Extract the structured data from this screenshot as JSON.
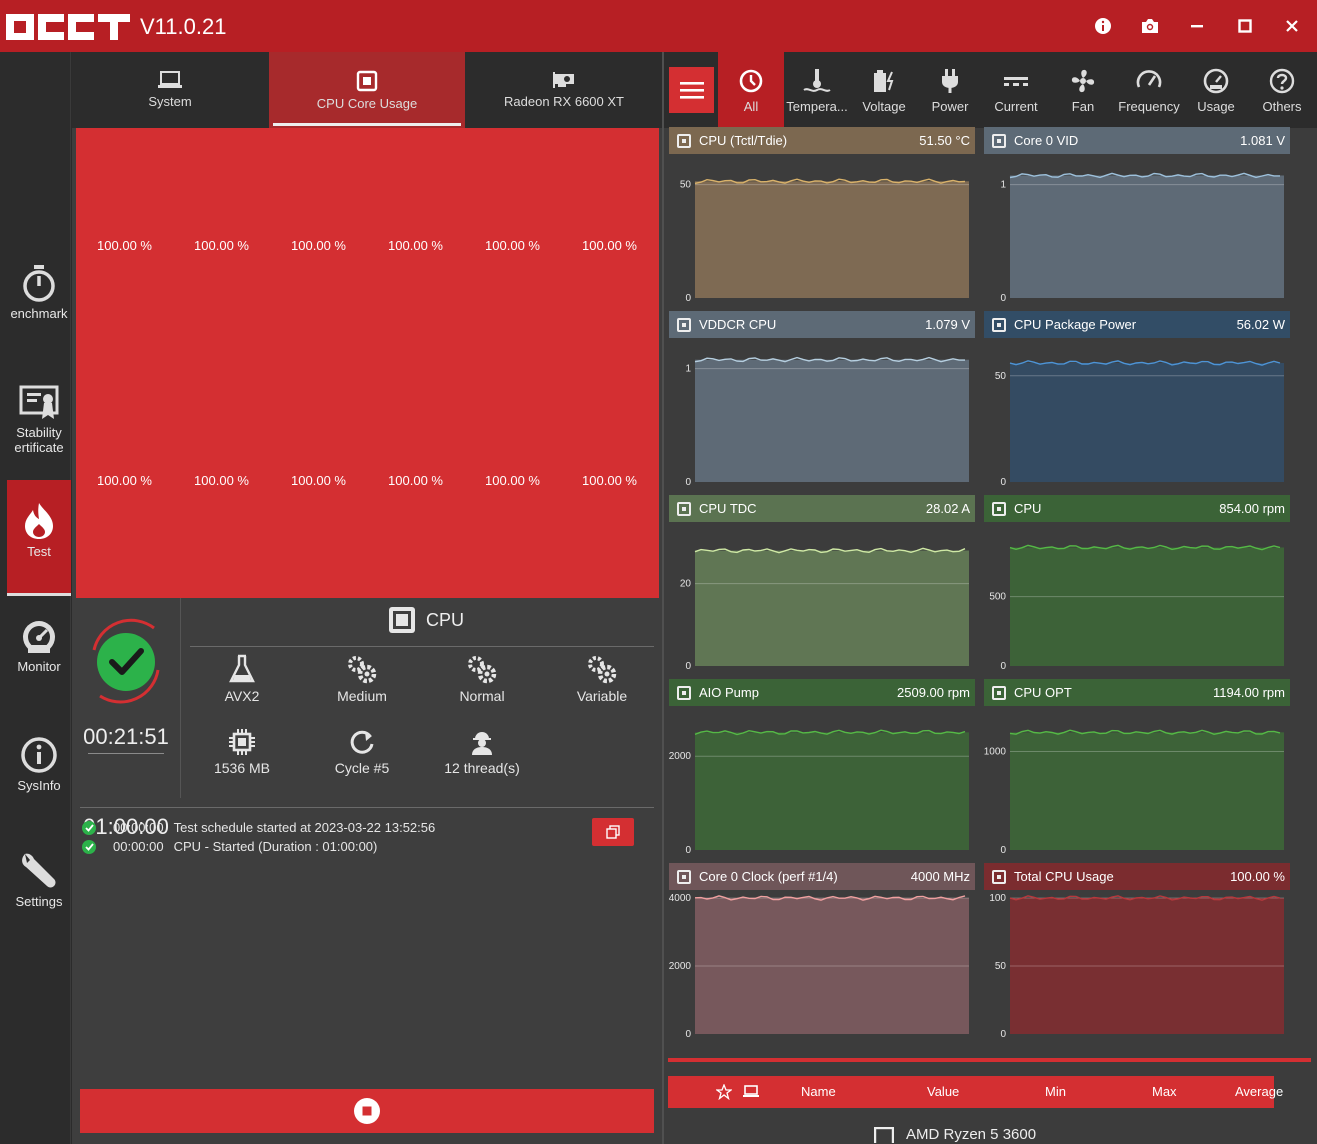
{
  "app": {
    "version": "V11.0.21"
  },
  "rail": {
    "items": [
      {
        "label": "enchmark"
      },
      {
        "label": "Stability ertificate"
      },
      {
        "label": "Test"
      },
      {
        "label": "Monitor"
      },
      {
        "label": "SysInfo"
      },
      {
        "label": "Settings"
      }
    ]
  },
  "test_tabs": [
    {
      "label": "System"
    },
    {
      "label": "CPU Core Usage"
    },
    {
      "label": "Radeon RX 6600 XT"
    }
  ],
  "cores": [
    "100.00 %",
    "100.00 %",
    "100.00 %",
    "100.00 %",
    "100.00 %",
    "100.00 %",
    "100.00 %",
    "100.00 %",
    "100.00 %",
    "100.00 %",
    "100.00 %",
    "100.00 %"
  ],
  "status": {
    "elapsed": "00:21:51",
    "duration": "01:00:00",
    "device": "CPU",
    "params": [
      {
        "label": "AVX2",
        "icon": "flask-icon"
      },
      {
        "label": "Medium",
        "icon": "gears-icon"
      },
      {
        "label": "Normal",
        "icon": "gears-icon"
      },
      {
        "label": "Variable",
        "icon": "gears-icon"
      },
      {
        "label": "1536 MB",
        "icon": "chip-icon"
      },
      {
        "label": "Cycle #5",
        "icon": "cycle-icon"
      },
      {
        "label": "12 thread(s)",
        "icon": "worker-icon"
      }
    ]
  },
  "log": [
    {
      "time": "00:00:00",
      "text": "Test schedule started at 2023-03-22 13:52:56"
    },
    {
      "time": "00:00:00",
      "text": "CPU - Started (Duration : 01:00:00)"
    }
  ],
  "monitor_tabs": [
    {
      "label": "All"
    },
    {
      "label": "Tempera..."
    },
    {
      "label": "Voltage"
    },
    {
      "label": "Power"
    },
    {
      "label": "Current"
    },
    {
      "label": "Fan"
    },
    {
      "label": "Frequency"
    },
    {
      "label": "Usage"
    },
    {
      "label": "Others"
    }
  ],
  "sensors": [
    {
      "name": "CPU (Tctl/Tdie)",
      "value": "51.50 °C",
      "ticks": [
        "50",
        "0"
      ],
      "tick_values": [
        50,
        0
      ],
      "ymax": 60,
      "level": 51.5,
      "head_color": "#7c6850",
      "fill": "#7e6a53",
      "line": "#d9b26a"
    },
    {
      "name": "Core 0 VID",
      "value": "1.081 V",
      "ticks": [
        "1",
        "0"
      ],
      "tick_values": [
        1,
        0
      ],
      "ymax": 1.2,
      "level": 1.081,
      "head_color": "#5d6a76",
      "fill": "#5e6a76",
      "line": "#9dc1dc"
    },
    {
      "name": "VDDCR CPU",
      "value": "1.079 V",
      "ticks": [
        "1",
        "0"
      ],
      "tick_values": [
        1,
        0
      ],
      "ymax": 1.2,
      "level": 1.079,
      "head_color": "#5d6a76",
      "fill": "#5e6a76",
      "line": "#b6cfe0"
    },
    {
      "name": "CPU Package Power",
      "value": "56.02 W",
      "ticks": [
        "50",
        "0"
      ],
      "tick_values": [
        50,
        0
      ],
      "ymax": 64,
      "level": 56.02,
      "head_color": "#324d66",
      "fill": "#344b62",
      "line": "#4d94d6"
    },
    {
      "name": "CPU TDC",
      "value": "28.02 A",
      "ticks": [
        "20",
        "0"
      ],
      "tick_values": [
        20,
        0
      ],
      "ymax": 33,
      "level": 28.02,
      "head_color": "#5b7351",
      "fill": "#607654",
      "line": "#cfe9a5"
    },
    {
      "name": "CPU",
      "value": "854.00 rpm",
      "ticks": [
        "500",
        "0"
      ],
      "tick_values": [
        500,
        0
      ],
      "ymax": 980,
      "level": 854,
      "head_color": "#3b6337",
      "fill": "#3d6238",
      "line": "#55b946"
    },
    {
      "name": "AIO Pump",
      "value": "2509.00 rpm",
      "ticks": [
        "2000",
        "0"
      ],
      "tick_values": [
        2000,
        0
      ],
      "ymax": 2900,
      "level": 2509,
      "head_color": "#3b6337",
      "fill": "#3d6238",
      "line": "#55b946"
    },
    {
      "name": "CPU OPT",
      "value": "1194.00 rpm",
      "ticks": [
        "1000",
        "0"
      ],
      "tick_values": [
        1000,
        0
      ],
      "ymax": 1380,
      "level": 1194,
      "head_color": "#3b6337",
      "fill": "#3d6238",
      "line": "#55b946"
    },
    {
      "name": "Core 0 Clock (perf #1/4)",
      "value": "4000 MHz",
      "ticks": [
        "4000",
        "2000",
        "0"
      ],
      "tick_values": [
        4000,
        2000,
        0
      ],
      "ymax": 4000,
      "level": 4000,
      "head_color": "#6f5659",
      "fill": "#77585c",
      "line": "#f0a0a0"
    },
    {
      "name": "Total CPU Usage",
      "value": "100.00 %",
      "ticks": [
        "100",
        "50",
        "0"
      ],
      "tick_values": [
        100,
        50,
        0
      ],
      "ymax": 100,
      "level": 100,
      "head_color": "#7b2c2f",
      "fill": "#792f32",
      "line": "#b8383c"
    }
  ],
  "table": {
    "headers": {
      "name": "Name",
      "value": "Value",
      "min": "Min",
      "max": "Max",
      "average": "Average"
    },
    "first_row": "AMD Ryzen 5 3600"
  },
  "colors": {
    "accent": "#d42f32",
    "titlebar": "#b71f24",
    "ok": "#2cb24a"
  }
}
